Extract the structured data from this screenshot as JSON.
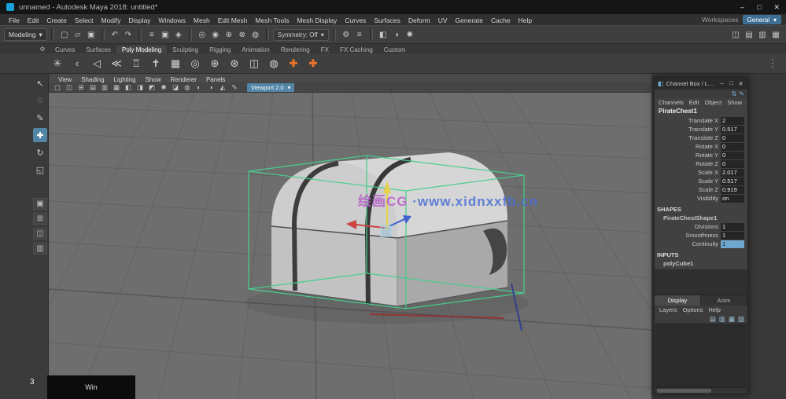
{
  "window": {
    "title": "unnamed - Autodesk Maya 2018: untitled*",
    "minimize": "–",
    "maximize": "□",
    "close": "✕"
  },
  "menubar": {
    "items": [
      "File",
      "Edit",
      "Create",
      "Select",
      "Modify",
      "Display",
      "Windows",
      "Mesh",
      "Edit Mesh",
      "Mesh Tools",
      "Mesh Display",
      "Curves",
      "Surfaces",
      "Deform",
      "UV",
      "Generate",
      "Cache",
      "Help"
    ],
    "workspace_label": "Workspaces",
    "workspace_value": "General",
    "caret": "▾"
  },
  "status": {
    "menuset": "Modeling",
    "caret": "▾",
    "file_icons": [
      {
        "name": "new-scene-icon",
        "glyph": "▢"
      },
      {
        "name": "open-scene-icon",
        "glyph": "▱"
      },
      {
        "name": "save-scene-icon",
        "glyph": "▣"
      }
    ],
    "undo_icons": [
      {
        "name": "undo-icon",
        "glyph": "↶"
      },
      {
        "name": "redo-icon",
        "glyph": "↷"
      }
    ],
    "selection_icons": [
      {
        "name": "select-hierarchy-icon",
        "glyph": "≡"
      },
      {
        "name": "select-object-icon",
        "glyph": "▣"
      },
      {
        "name": "select-component-icon",
        "glyph": "◈"
      }
    ],
    "snap_icons": [
      {
        "name": "snap-grid-icon",
        "glyph": "◎"
      },
      {
        "name": "snap-curve-icon",
        "glyph": "◉"
      },
      {
        "name": "snap-point-icon",
        "glyph": "⊕"
      },
      {
        "name": "snap-plane-icon",
        "glyph": "⊗"
      },
      {
        "name": "make-live-icon",
        "glyph": "◍"
      }
    ],
    "symmetry_label": "Symmetry: Off",
    "history_icons": [
      {
        "name": "construction-history-icon",
        "glyph": "⚙"
      },
      {
        "name": "input-operations-icon",
        "glyph": "≡"
      }
    ],
    "render_icons": [
      {
        "name": "render-frame-icon",
        "glyph": "◧"
      },
      {
        "name": "ipr-render-icon",
        "glyph": "◑"
      },
      {
        "name": "render-settings-icon",
        "glyph": "✺"
      }
    ],
    "right_icons": [
      {
        "name": "modeling-toolkit-toggle-icon",
        "glyph": "◫"
      },
      {
        "name": "attribute-editor-toggle-icon",
        "glyph": "▤"
      },
      {
        "name": "tool-settings-toggle-icon",
        "glyph": "▥"
      },
      {
        "name": "channel-box-toggle-icon",
        "glyph": "▦"
      }
    ]
  },
  "shelf": {
    "gear_glyph": "⚙",
    "tabs": [
      {
        "name": "shelf-tab-curves",
        "label": "Curves"
      },
      {
        "name": "shelf-tab-surfaces",
        "label": "Surfaces"
      },
      {
        "name": "shelf-tab-poly-modeling",
        "label": "Poly Modeling",
        "active": true
      },
      {
        "name": "shelf-tab-sculpting",
        "label": "Sculpting"
      },
      {
        "name": "shelf-tab-rigging",
        "label": "Rigging"
      },
      {
        "name": "shelf-tab-animation",
        "label": "Animation"
      },
      {
        "name": "shelf-tab-rendering",
        "label": "Rendering"
      },
      {
        "name": "shelf-tab-fx",
        "label": "FX"
      },
      {
        "name": "shelf-tab-fx-caching",
        "label": "FX Caching"
      },
      {
        "name": "shelf-tab-custom",
        "label": "Custom"
      }
    ],
    "icons": [
      {
        "name": "multi-cut-icon",
        "glyph": "✳"
      },
      {
        "name": "target-weld-icon",
        "glyph": "‹"
      },
      {
        "name": "connect-icon",
        "glyph": "◁"
      },
      {
        "name": "quad-draw-icon",
        "glyph": "≪"
      },
      {
        "name": "bridge-icon",
        "glyph": "♖"
      },
      {
        "name": "extrude-icon",
        "glyph": "✝"
      },
      {
        "name": "bevel-icon",
        "glyph": "▦"
      },
      {
        "name": "smooth-icon",
        "glyph": "◎"
      },
      {
        "name": "combine-icon",
        "glyph": "⊕"
      },
      {
        "name": "separate-icon",
        "glyph": "⊛"
      },
      {
        "name": "mirror-icon",
        "glyph": "◫"
      },
      {
        "name": "boolean-icon",
        "glyph": "◍"
      },
      {
        "name": "add-shelf-item-icon",
        "glyph": "✚",
        "cls": "orange"
      },
      {
        "name": "add-shelf-tab-icon",
        "glyph": "✚",
        "cls": "orange"
      }
    ],
    "overflow_glyph": "⋮"
  },
  "toolbox": {
    "tools": [
      {
        "name": "select-tool",
        "glyph": "↖"
      },
      {
        "name": "lasso-tool",
        "glyph": "◌"
      },
      {
        "name": "paint-select-tool",
        "glyph": "✎"
      },
      {
        "name": "move-tool",
        "glyph": "✚",
        "active": true
      },
      {
        "name": "rotate-tool",
        "glyph": "↻"
      },
      {
        "name": "scale-tool",
        "glyph": "◱"
      }
    ],
    "layouts": [
      {
        "name": "layout-single-pane",
        "glyph": "▣"
      },
      {
        "name": "layout-four-pane",
        "glyph": "⊞"
      },
      {
        "name": "layout-two-pane",
        "glyph": "◫"
      },
      {
        "name": "layout-outliner-persp",
        "glyph": "▥"
      }
    ]
  },
  "viewport": {
    "menus": [
      "View",
      "Shading",
      "Lighting",
      "Show",
      "Renderer",
      "Panels"
    ],
    "toolbar_icons": [
      {
        "name": "select-camera-icon",
        "glyph": "▢"
      },
      {
        "name": "lock-camera-icon",
        "glyph": "◫"
      },
      {
        "name": "camera-attributes-icon",
        "glyph": "⊞"
      },
      {
        "name": "bookmark-icon",
        "glyph": "▤"
      },
      {
        "name": "image-plane-icon",
        "glyph": "▥"
      },
      {
        "name": "two-d-pan-zoom-icon",
        "glyph": "▦"
      },
      {
        "name": "wireframe-icon",
        "glyph": "◧"
      },
      {
        "name": "shaded-icon",
        "glyph": "◨"
      },
      {
        "name": "textured-icon",
        "glyph": "◩"
      },
      {
        "name": "lighting-icon",
        "glyph": "✺"
      },
      {
        "name": "shadows-icon",
        "glyph": "◪"
      },
      {
        "name": "screen-space-ao-icon",
        "glyph": "◍"
      },
      {
        "name": "motion-blur-icon",
        "glyph": "◐"
      },
      {
        "name": "multisample-icon",
        "glyph": "◑"
      },
      {
        "name": "isolate-select-icon",
        "glyph": "◭"
      },
      {
        "name": "grease-pencil-icon",
        "glyph": "✎"
      }
    ],
    "renderer_dropdown": "Viewport 2.0",
    "dropdown_caret": "▾",
    "watermark_part1": "绘画CG",
    "watermark_part2": "·www.xidnxxfb.cn"
  },
  "channelbox": {
    "icon_glyph": "◧",
    "title": "Channel Box / L...",
    "minimize": "–",
    "maximize": "□",
    "close": "✕",
    "header_icons": [
      {
        "name": "channel-sliders-icon",
        "glyph": "⇅"
      },
      {
        "name": "speed-state-icon",
        "glyph": "✎"
      }
    ],
    "menus": [
      "Channels",
      "Edit",
      "Object",
      "Show"
    ],
    "object_name": "PirateChest1",
    "channels": [
      {
        "name": "channel-translate-x",
        "label": "Translate X",
        "value": "2"
      },
      {
        "name": "channel-translate-y",
        "label": "Translate Y",
        "value": "0.517"
      },
      {
        "name": "channel-translate-z",
        "label": "Translate Z",
        "value": "0"
      },
      {
        "name": "channel-rotate-x",
        "label": "Rotate X",
        "value": "0"
      },
      {
        "name": "channel-rotate-y",
        "label": "Rotate Y",
        "value": "0"
      },
      {
        "name": "channel-rotate-z",
        "label": "Rotate Z",
        "value": "0"
      },
      {
        "name": "channel-scale-x",
        "label": "Scale X",
        "value": "2.017"
      },
      {
        "name": "channel-scale-y",
        "label": "Scale Y",
        "value": "0.517"
      },
      {
        "name": "channel-scale-z",
        "label": "Scale Z",
        "value": "0.919"
      },
      {
        "name": "channel-visibility",
        "label": "Visibility",
        "value": "on"
      }
    ],
    "shapes_header": "SHAPES",
    "shape_name": "PirateChestShape1",
    "shape_channels": [
      {
        "name": "channel-divisions",
        "label": "Divisions",
        "value": "1"
      },
      {
        "name": "channel-smoothness",
        "label": "Smoothness",
        "value": "1"
      },
      {
        "name": "channel-continuity",
        "label": "Continuity",
        "value": "1",
        "highlight": true
      }
    ],
    "inputs_header": "INPUTS",
    "input_name": "polyCube1",
    "layer_editor": {
      "tabs": [
        {
          "name": "tab-display",
          "label": "Display",
          "active": true
        },
        {
          "name": "tab-anim",
          "label": "Anim"
        }
      ],
      "menus": [
        "Layers",
        "Options",
        "Help"
      ],
      "icons": [
        {
          "name": "move-layer-up-icon",
          "glyph": "▤"
        },
        {
          "name": "new-empty-layer-icon",
          "glyph": "▥"
        },
        {
          "name": "new-layer-from-selected-icon",
          "glyph": "▦"
        },
        {
          "name": "new-anim-layer-icon",
          "glyph": "▧"
        }
      ]
    }
  },
  "overlay": {
    "key_display": "Win",
    "hud_number": "3"
  },
  "colors": {
    "accent_blue": "#5285a6",
    "selection_green": "#46cf8e",
    "shelf_orange": "#e8732a",
    "manip_red": "#cc4444",
    "manip_yellow": "#e6d24a",
    "manip_blue": "#4060cf",
    "watermark_blue": "#4a6fd4",
    "watermark_magenta": "#b75fc9"
  }
}
